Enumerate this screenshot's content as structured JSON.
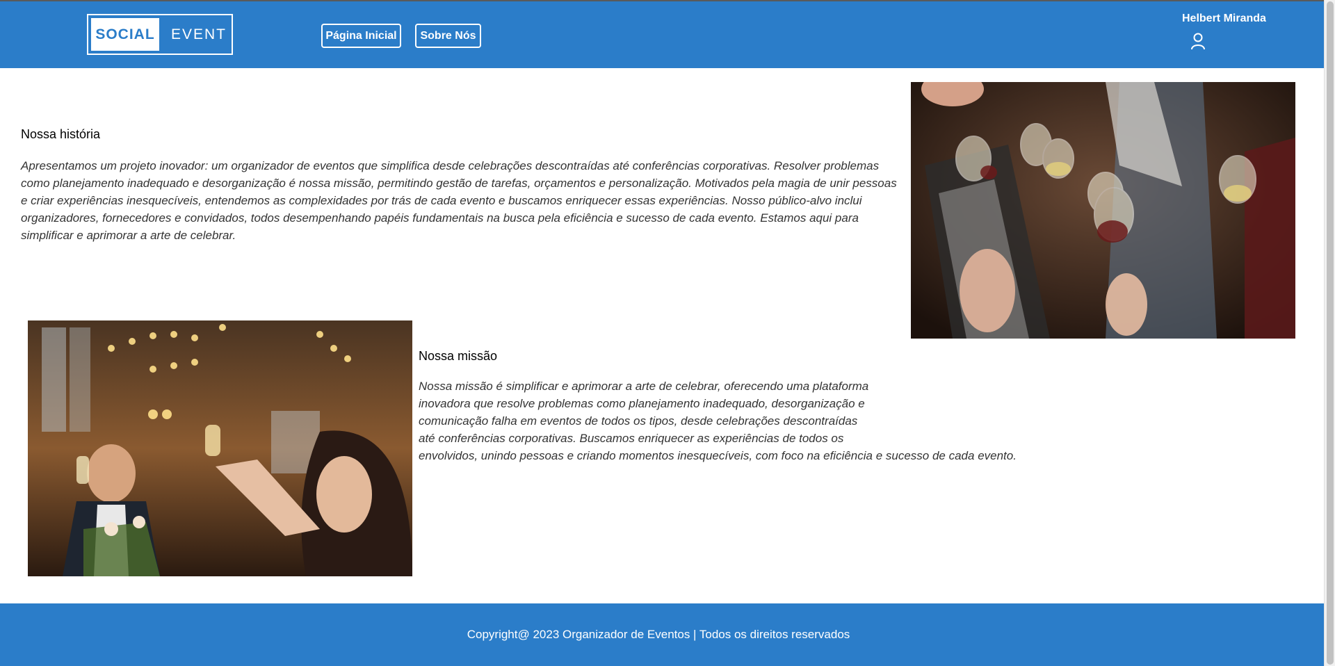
{
  "header": {
    "logo": {
      "part1": "SOCIAL",
      "part2": "EVENT"
    },
    "nav": {
      "home": "Página Inicial",
      "about": "Sobre Nós"
    },
    "user": {
      "name": "Helbert Miranda",
      "icon": "user-icon"
    }
  },
  "history": {
    "title": "Nossa história",
    "text": "Apresentamos um projeto inovador: um organizador de eventos que simplifica desde celebrações descontraídas até conferências corporativas. Resolver problemas como planejamento inadequado e desorganização é nossa missão, permitindo gestão de tarefas, orçamentos e personalização. Motivados pela magia de unir pessoas e criar experiências inesquecíveis, entendemos as complexidades por trás de cada evento e buscamos enriquecer essas experiências. Nosso público-alvo inclui organizadores, fornecedores e convidados, todos desempenhando papéis fundamentais na busca pela eficiência e sucesso de cada evento. Estamos aqui para simplificar e aprimorar a arte de celebrar."
  },
  "mission": {
    "title": "Nossa missão",
    "lines": [
      "Nossa missão é simplificar e aprimorar a arte de celebrar, oferecendo uma plataforma",
      "inovadora que resolve problemas como planejamento inadequado, desorganização e",
      "comunicação falha em eventos de todos os tipos, desde celebrações descontraídas",
      "até conferências corporativas. Buscamos enriquecer as experiências de todos os",
      "envolvidos, unindo pessoas e criando momentos inesquecíveis, com foco na eficiência e sucesso de cada evento."
    ]
  },
  "footer": {
    "text": "Copyright@ 2023 Organizador de Eventos | Todos os direitos reservados"
  },
  "colors": {
    "brand": "#2b7dc9",
    "white": "#ffffff"
  }
}
